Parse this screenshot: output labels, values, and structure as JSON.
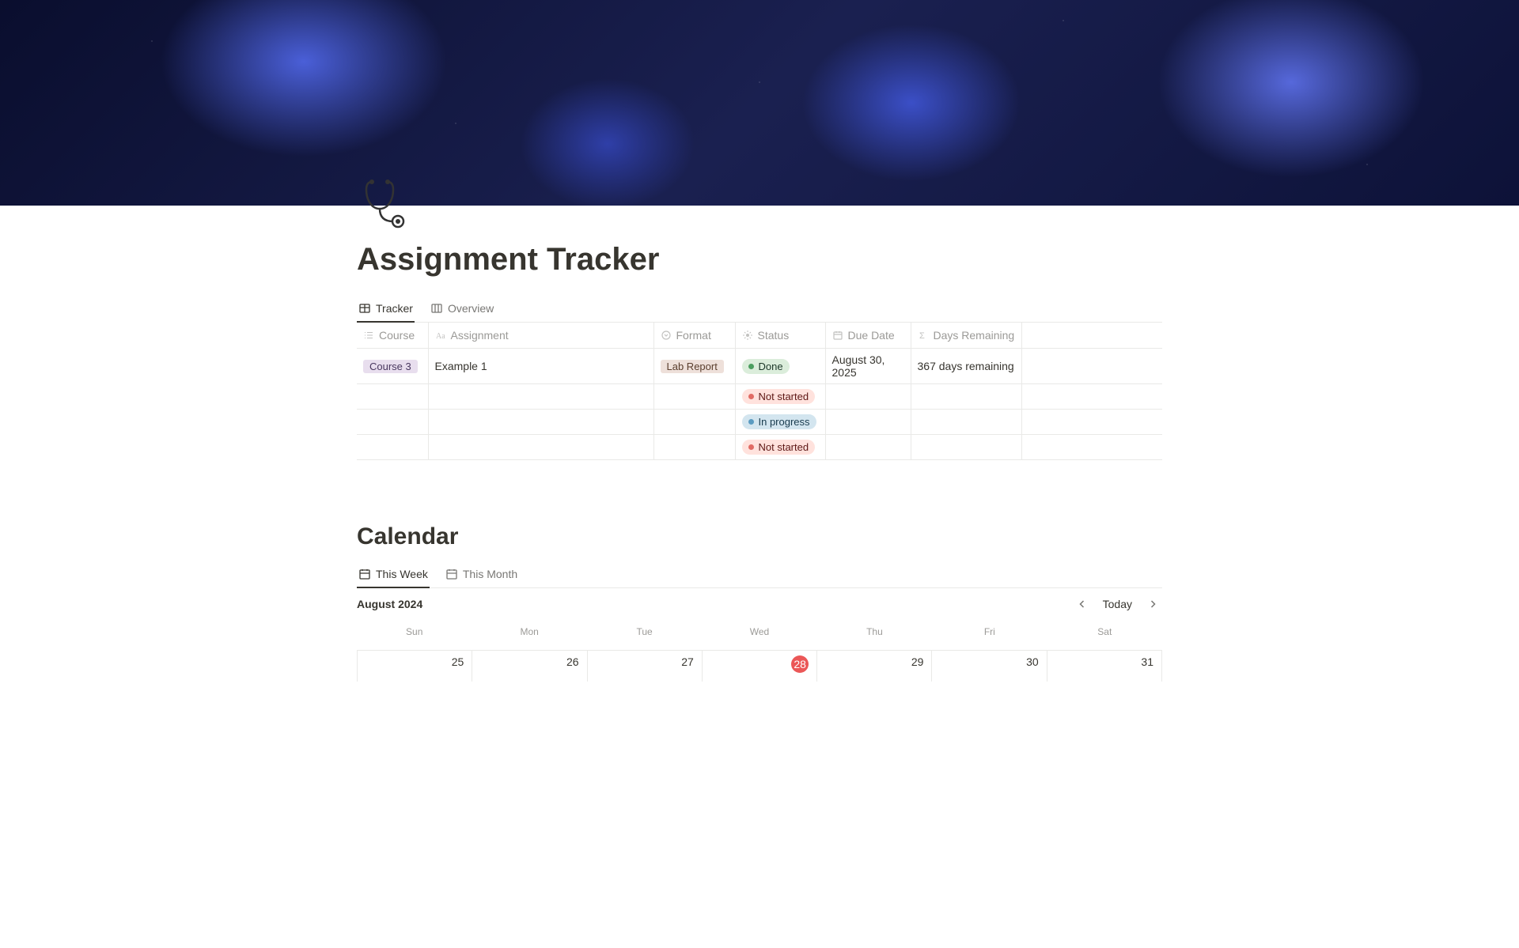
{
  "page": {
    "title": "Assignment Tracker",
    "emoji": "🩺"
  },
  "tabs": [
    {
      "label": "Tracker",
      "active": true,
      "icon": "table"
    },
    {
      "label": "Overview",
      "active": false,
      "icon": "board"
    }
  ],
  "columns": {
    "course": "Course",
    "assignment": "Assignment",
    "format": "Format",
    "status": "Status",
    "dueDate": "Due Date",
    "daysRemaining": "Days Remaining"
  },
  "rows": [
    {
      "course": "Course 3",
      "assignment": "Example 1",
      "format": "Lab Report",
      "status": {
        "label": "Done",
        "variant": "green"
      },
      "dueDate": "August 30, 2025",
      "daysRemaining": "367 days remaining"
    },
    {
      "course": "",
      "assignment": "",
      "format": "",
      "status": {
        "label": "Not started",
        "variant": "red"
      },
      "dueDate": "",
      "daysRemaining": ""
    },
    {
      "course": "",
      "assignment": "",
      "format": "",
      "status": {
        "label": "In progress",
        "variant": "blue"
      },
      "dueDate": "",
      "daysRemaining": ""
    },
    {
      "course": "",
      "assignment": "",
      "format": "",
      "status": {
        "label": "Not started",
        "variant": "red"
      },
      "dueDate": "",
      "daysRemaining": ""
    }
  ],
  "calendar": {
    "title": "Calendar",
    "tabs": [
      {
        "label": "This Week",
        "active": true
      },
      {
        "label": "This Month",
        "active": false
      }
    ],
    "monthLabel": "August 2024",
    "todayLabel": "Today",
    "dayNames": [
      "Sun",
      "Mon",
      "Tue",
      "Wed",
      "Thu",
      "Fri",
      "Sat"
    ],
    "days": [
      {
        "num": "25",
        "today": false
      },
      {
        "num": "26",
        "today": false
      },
      {
        "num": "27",
        "today": false
      },
      {
        "num": "28",
        "today": true
      },
      {
        "num": "29",
        "today": false
      },
      {
        "num": "30",
        "today": false
      },
      {
        "num": "31",
        "today": false
      }
    ]
  }
}
